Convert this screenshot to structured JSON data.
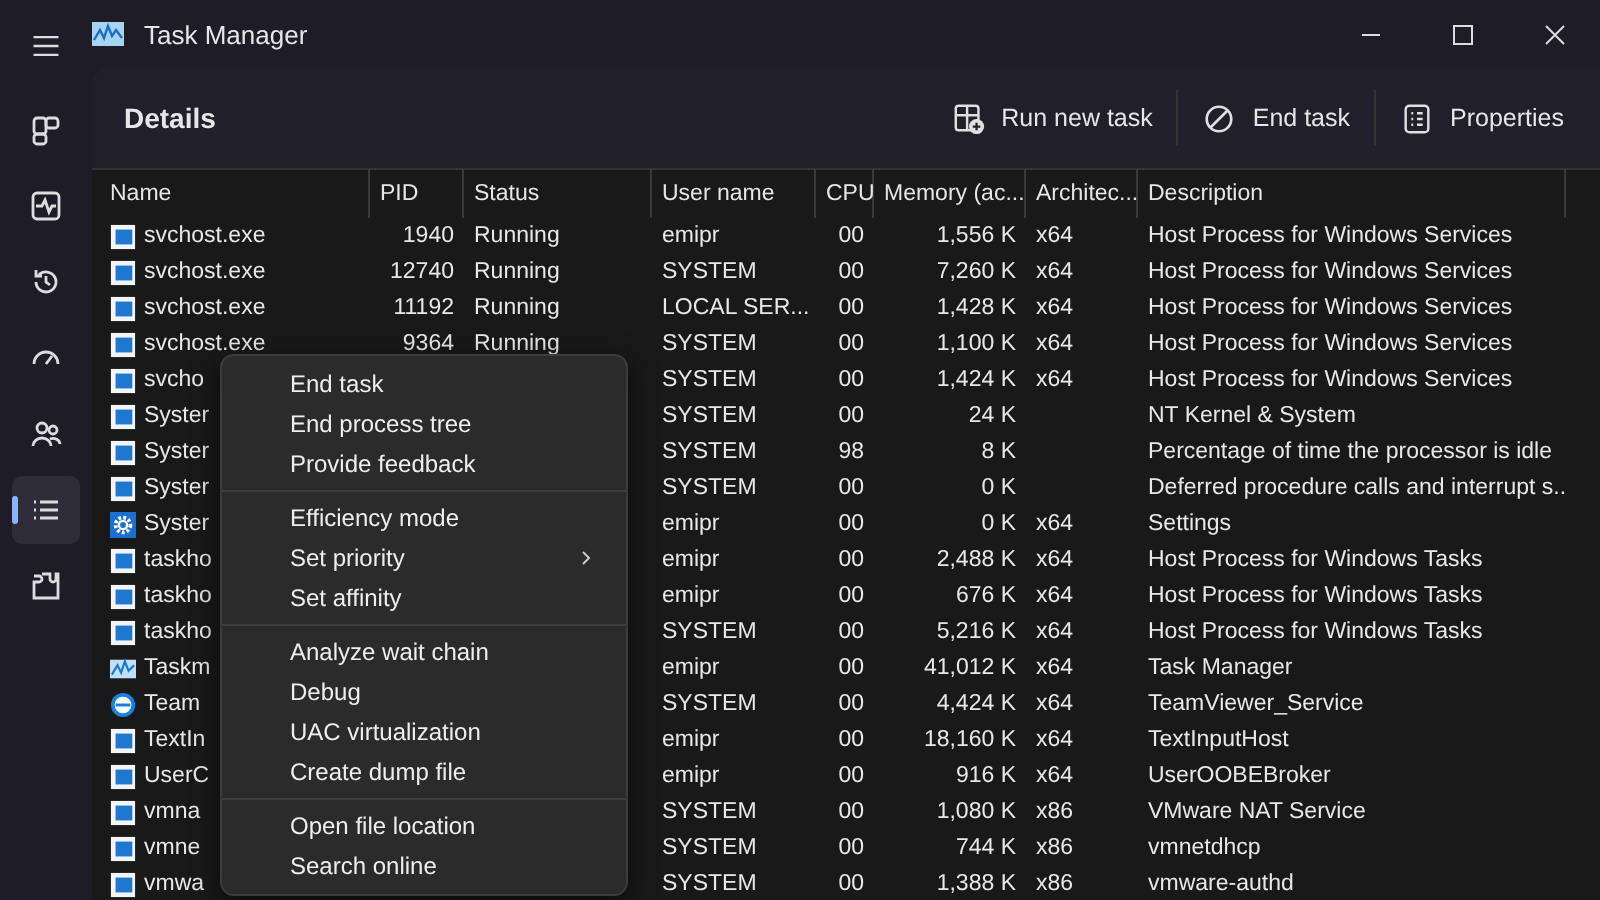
{
  "window": {
    "title": "Task Manager"
  },
  "sidebar": {
    "items": [
      {
        "kind": "processes",
        "selected": false
      },
      {
        "kind": "performance",
        "selected": false
      },
      {
        "kind": "history",
        "selected": false
      },
      {
        "kind": "startup",
        "selected": false
      },
      {
        "kind": "users",
        "selected": false
      },
      {
        "kind": "details",
        "selected": true
      },
      {
        "kind": "services",
        "selected": false
      }
    ]
  },
  "header": {
    "title": "Details",
    "actions": [
      {
        "kind": "run",
        "label": "Run new task"
      },
      {
        "kind": "end",
        "label": "End task"
      },
      {
        "kind": "properties",
        "label": "Properties"
      }
    ]
  },
  "table": {
    "columns": [
      "Name",
      "PID",
      "Status",
      "User name",
      "CPU",
      "Memory (ac...",
      "Architec...",
      "Description"
    ],
    "rows": [
      {
        "kind": "app",
        "name": "svchost.exe",
        "pid": "1940",
        "status": "Running",
        "user": "emipr",
        "cpu": "00",
        "memory": "1,556 K",
        "arch": "x64",
        "description": "Host Process for Windows Services"
      },
      {
        "kind": "app",
        "name": "svchost.exe",
        "pid": "12740",
        "status": "Running",
        "user": "SYSTEM",
        "cpu": "00",
        "memory": "7,260 K",
        "arch": "x64",
        "description": "Host Process for Windows Services"
      },
      {
        "kind": "app",
        "name": "svchost.exe",
        "pid": "11192",
        "status": "Running",
        "user": "LOCAL SER...",
        "cpu": "00",
        "memory": "1,428 K",
        "arch": "x64",
        "description": "Host Process for Windows Services"
      },
      {
        "kind": "app",
        "name": "svchost.exe",
        "pid": "9364",
        "status": "Running",
        "user": "SYSTEM",
        "cpu": "00",
        "memory": "1,100 K",
        "arch": "x64",
        "description": "Host Process for Windows Services"
      },
      {
        "kind": "app",
        "name": "svcho",
        "user": "SYSTEM",
        "cpu": "00",
        "memory": "1,424 K",
        "arch": "x64",
        "description": "Host Process for Windows Services"
      },
      {
        "kind": "app",
        "name": "Syster",
        "user": "SYSTEM",
        "cpu": "00",
        "memory": "24 K",
        "description": "NT Kernel & System"
      },
      {
        "kind": "app",
        "name": "Syster",
        "user": "SYSTEM",
        "cpu": "98",
        "memory": "8 K",
        "description": "Percentage of time the processor is idle"
      },
      {
        "kind": "app",
        "name": "Syster",
        "user": "SYSTEM",
        "cpu": "00",
        "memory": "0 K",
        "description": "Deferred procedure calls and interrupt s..."
      },
      {
        "kind": "gear",
        "name": "Syster",
        "user": "emipr",
        "cpu": "00",
        "memory": "0 K",
        "arch": "x64",
        "description": "Settings"
      },
      {
        "kind": "app",
        "name": "taskho",
        "user": "emipr",
        "cpu": "00",
        "memory": "2,488 K",
        "arch": "x64",
        "description": "Host Process for Windows Tasks"
      },
      {
        "kind": "app",
        "name": "taskho",
        "user": "emipr",
        "cpu": "00",
        "memory": "676 K",
        "arch": "x64",
        "description": "Host Process for Windows Tasks"
      },
      {
        "kind": "app",
        "name": "taskho",
        "user": "SYSTEM",
        "cpu": "00",
        "memory": "5,216 K",
        "arch": "x64",
        "description": "Host Process for Windows Tasks"
      },
      {
        "kind": "chart",
        "name": "Taskm",
        "user": "emipr",
        "cpu": "00",
        "memory": "41,012 K",
        "arch": "x64",
        "description": "Task Manager"
      },
      {
        "kind": "remote",
        "name": "Team",
        "user": "SYSTEM",
        "cpu": "00",
        "memory": "4,424 K",
        "arch": "x64",
        "description": "TeamViewer_Service"
      },
      {
        "kind": "app",
        "name": "TextIn",
        "user": "emipr",
        "cpu": "00",
        "memory": "18,160 K",
        "arch": "x64",
        "description": "TextInputHost"
      },
      {
        "kind": "app",
        "name": "UserC",
        "user": "emipr",
        "cpu": "00",
        "memory": "916 K",
        "arch": "x64",
        "description": "UserOOBEBroker"
      },
      {
        "kind": "app",
        "name": "vmna",
        "user": "SYSTEM",
        "cpu": "00",
        "memory": "1,080 K",
        "arch": "x86",
        "description": "VMware NAT Service"
      },
      {
        "kind": "app",
        "name": "vmne",
        "user": "SYSTEM",
        "cpu": "00",
        "memory": "744 K",
        "arch": "x86",
        "description": "vmnetdhcp"
      },
      {
        "kind": "app",
        "name": "vmwa",
        "user": "SYSTEM",
        "cpu": "00",
        "memory": "1,388 K",
        "arch": "x86",
        "description": "vmware-authd"
      }
    ]
  },
  "context_menu": {
    "groups": [
      [
        {
          "label": "End task",
          "submenu": false
        },
        {
          "label": "End process tree",
          "submenu": false
        },
        {
          "label": "Provide feedback",
          "submenu": false
        }
      ],
      [
        {
          "label": "Efficiency mode",
          "submenu": false
        },
        {
          "label": "Set priority",
          "submenu": true
        },
        {
          "label": "Set affinity",
          "submenu": false
        }
      ],
      [
        {
          "label": "Analyze wait chain",
          "submenu": false
        },
        {
          "label": "Debug",
          "submenu": false
        },
        {
          "label": "UAC virtualization",
          "submenu": false
        },
        {
          "label": "Create dump file",
          "submenu": false
        }
      ],
      [
        {
          "label": "Open file location",
          "submenu": false
        },
        {
          "label": "Search online",
          "submenu": false
        }
      ]
    ]
  }
}
